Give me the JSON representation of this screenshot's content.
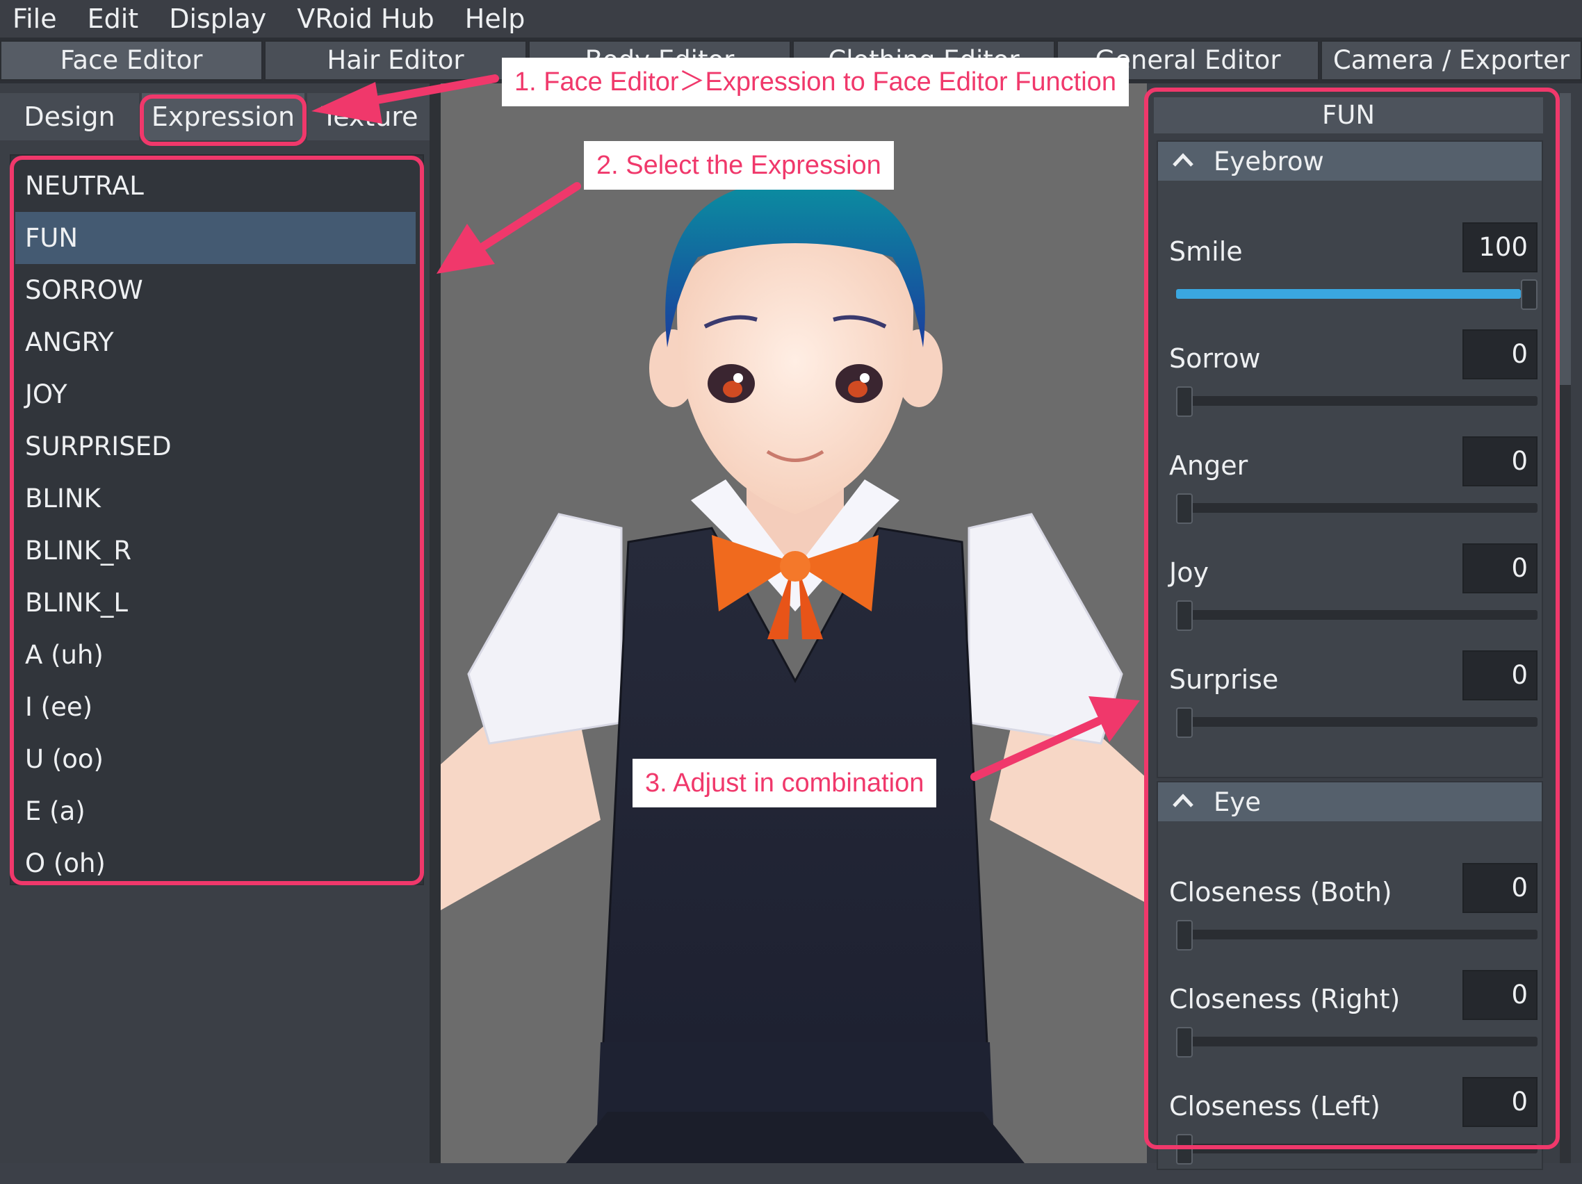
{
  "menu": [
    "File",
    "Edit",
    "Display",
    "VRoid Hub",
    "Help"
  ],
  "editor_tabs": [
    "Face Editor",
    "Hair Editor",
    "Body Editor",
    "Clothing Editor",
    "General Editor",
    "Camera / Exporter"
  ],
  "sub_tabs": [
    "Design",
    "Expression",
    "Texture"
  ],
  "expressions": [
    "NEUTRAL",
    "FUN",
    "SORROW",
    "ANGRY",
    "JOY",
    "SURPRISED",
    "BLINK",
    "BLINK_R",
    "BLINK_L",
    "A (uh)",
    "I (ee)",
    "U (oo)",
    "E (a)",
    "O (oh)"
  ],
  "selected_expression": "FUN",
  "panel_title": "FUN",
  "eyebrow": {
    "title": "Eyebrow",
    "params": [
      {
        "label": "Smile",
        "value": "100",
        "level": 1.0
      },
      {
        "label": "Sorrow",
        "value": "0",
        "level": 0
      },
      {
        "label": "Anger",
        "value": "0",
        "level": 0
      },
      {
        "label": "Joy",
        "value": "0",
        "level": 0
      },
      {
        "label": "Surprise",
        "value": "0",
        "level": 0
      }
    ]
  },
  "eye": {
    "title": "Eye",
    "params": [
      {
        "label": "Closeness (Both)",
        "value": "0",
        "level": 0
      },
      {
        "label": "Closeness (Right)",
        "value": "0",
        "level": 0
      },
      {
        "label": "Closeness (Left)",
        "value": "0",
        "level": 0
      }
    ]
  },
  "annotations": {
    "step1": "1. Face Editor＞Expression to Face Editor Function",
    "step2": "2. Select the Expression",
    "step3": "3. Adjust in combination"
  },
  "colors": {
    "accent_pink": "#f0386b",
    "slider_blue": "#3aa7e0",
    "selected_row": "#445a72"
  }
}
